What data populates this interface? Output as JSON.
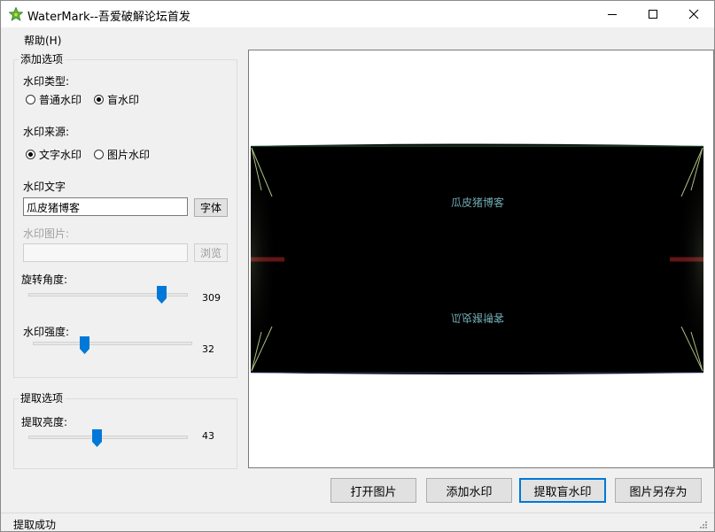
{
  "window": {
    "title": "WaterMark--吾爱破解论坛首发",
    "app_icon": "app-star-icon"
  },
  "menu": {
    "help": "帮助(H)"
  },
  "add_options": {
    "legend": "添加选项",
    "type_label": "水印类型:",
    "type_options": [
      {
        "label": "普通水印",
        "selected": false
      },
      {
        "label": "盲水印",
        "selected": true
      }
    ],
    "source_label": "水印来源:",
    "source_options": [
      {
        "label": "文字水印",
        "selected": true
      },
      {
        "label": "图片水印",
        "selected": false
      }
    ],
    "text_label": "水印文字",
    "text_value": "瓜皮猪博客",
    "font_button": "字体",
    "image_label": "水印图片:",
    "image_value": "",
    "browse_button": "浏览",
    "rotation_label": "旋转角度:",
    "rotation_value": "309",
    "rotation_range": [
      0,
      360
    ],
    "strength_label": "水印强度:",
    "strength_value": "32",
    "strength_range": [
      0,
      100
    ]
  },
  "extract_options": {
    "legend": "提取选项",
    "brightness_label": "提取亮度:",
    "brightness_value": "43",
    "brightness_range": [
      0,
      100
    ]
  },
  "preview": {
    "watermark_text": "瓜皮猪博客",
    "mirrored_text": "瓜皮猪博客"
  },
  "buttons": {
    "open": "打开图片",
    "add": "添加水印",
    "extract": "提取盲水印",
    "save_as": "图片另存为"
  },
  "status": {
    "text": "提取成功"
  },
  "colors": {
    "accent": "#0078d7",
    "watermark_text": "#6fa9b0"
  }
}
